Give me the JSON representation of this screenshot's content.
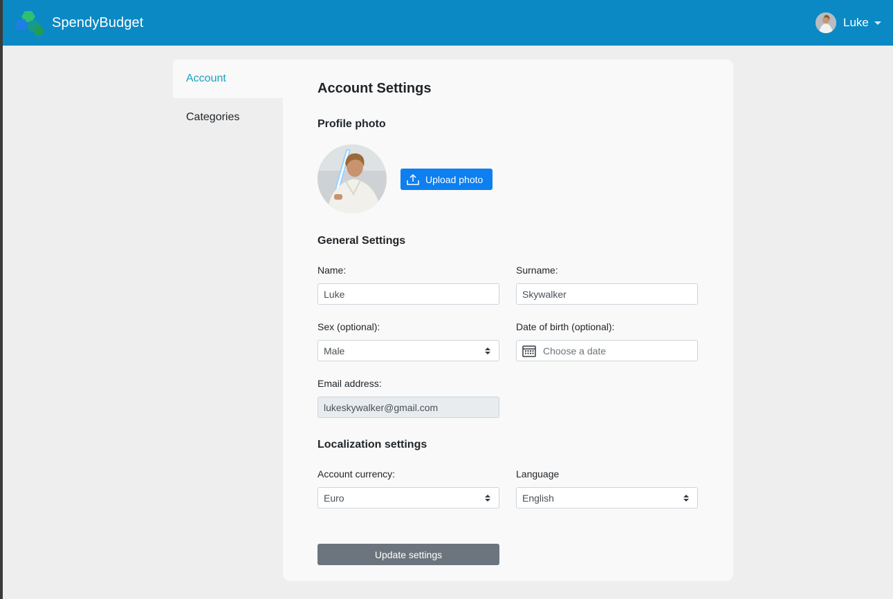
{
  "app": {
    "name": "SpendyBudget"
  },
  "user_menu": {
    "name": "Luke"
  },
  "sidebar": {
    "items": [
      {
        "label": "Account",
        "active": true
      },
      {
        "label": "Categories",
        "active": false
      }
    ]
  },
  "page": {
    "title": "Account Settings",
    "profile": {
      "heading": "Profile photo",
      "upload_label": "Upload photo"
    },
    "general": {
      "heading": "General Settings",
      "name_label": "Name:",
      "name_value": "Luke",
      "surname_label": "Surname:",
      "surname_value": "Skywalker",
      "sex_label": "Sex (optional):",
      "sex_value": "Male",
      "dob_label": "Date of birth (optional):",
      "dob_placeholder": "Choose a date",
      "email_label": "Email address:",
      "email_value": "lukeskywalker@gmail.com"
    },
    "localization": {
      "heading": "Localization settings",
      "currency_label": "Account currency:",
      "currency_value": "Euro",
      "language_label": "Language",
      "language_value": "English"
    },
    "update_label": "Update settings"
  },
  "colors": {
    "navbar": "#0a89c4",
    "active_link": "#17a2c2",
    "upload_button": "#0d7ff0",
    "update_button": "#6c757d",
    "panel": "#f9f9f9",
    "page_background": "#eeeeee"
  },
  "icons": [
    "logo-icon",
    "chevron-down-icon",
    "upload-icon",
    "calendar-icon",
    "select-arrows-icon"
  ]
}
